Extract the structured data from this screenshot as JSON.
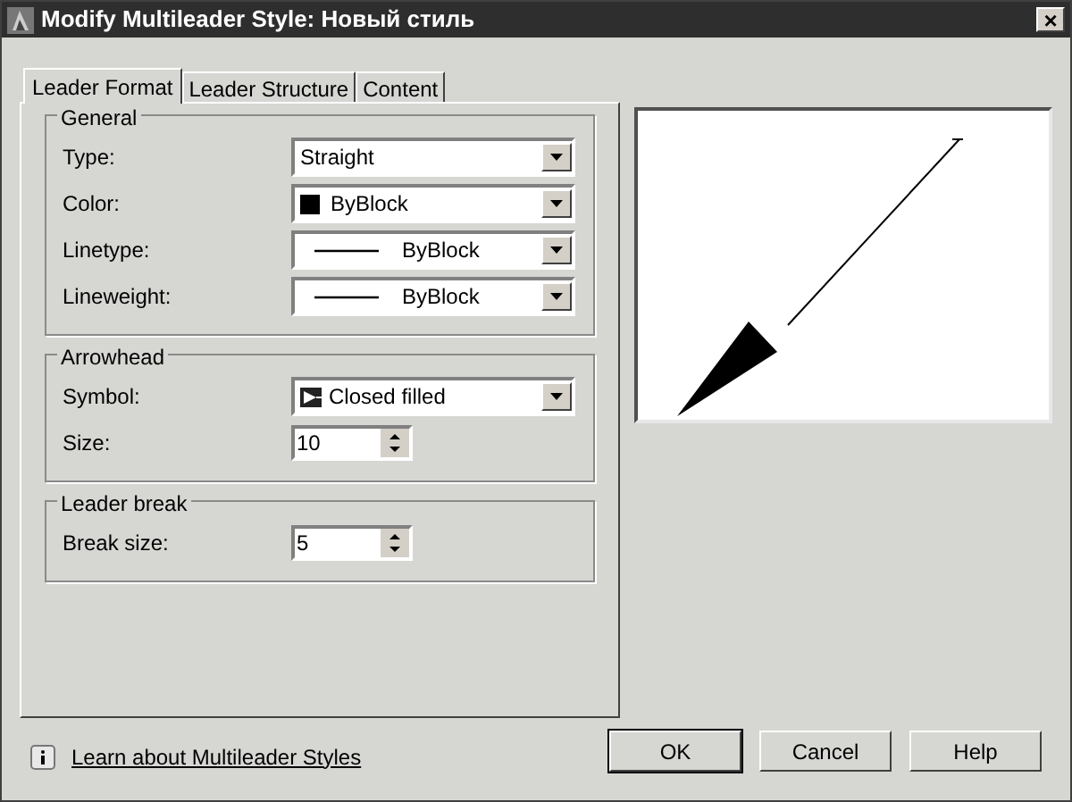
{
  "window": {
    "title": "Modify Multileader Style: Новый стиль",
    "close": "×"
  },
  "tabs": [
    {
      "label": "Leader Format",
      "selected": true
    },
    {
      "label": "Leader Structure",
      "selected": false
    },
    {
      "label": "Content",
      "selected": false
    }
  ],
  "groups": [
    {
      "title": "General",
      "fields": [
        {
          "label": "Type:",
          "kind": "select",
          "value": "Straight"
        },
        {
          "label": "Color:",
          "kind": "color-select",
          "value": "ByBlock"
        },
        {
          "label": "Linetype:",
          "kind": "line-select",
          "value": "ByBlock"
        },
        {
          "label": "Lineweight:",
          "kind": "line-select",
          "value": "ByBlock"
        }
      ]
    },
    {
      "title": "Arrowhead",
      "fields": [
        {
          "label": "Symbol:",
          "kind": "symbol-select",
          "value": "Closed filled"
        },
        {
          "label": "Size:",
          "kind": "spinner",
          "value": "10"
        }
      ]
    },
    {
      "title": "Leader break",
      "fields": [
        {
          "label": "Break size:",
          "kind": "spinner",
          "value": "5"
        }
      ]
    }
  ],
  "footer": {
    "link": "Learn about Multileader Styles",
    "buttons": [
      "OK",
      "Cancel",
      "Help"
    ]
  }
}
